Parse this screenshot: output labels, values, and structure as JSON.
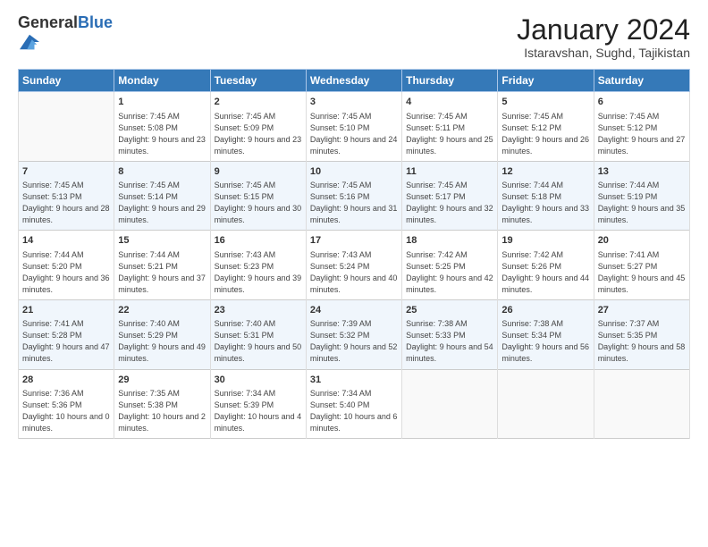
{
  "header": {
    "logo_general": "General",
    "logo_blue": "Blue",
    "month_title": "January 2024",
    "location": "Istaravshan, Sughd, Tajikistan"
  },
  "days_of_week": [
    "Sunday",
    "Monday",
    "Tuesday",
    "Wednesday",
    "Thursday",
    "Friday",
    "Saturday"
  ],
  "weeks": [
    [
      {
        "day": "",
        "sunrise": "",
        "sunset": "",
        "daylight": ""
      },
      {
        "day": "1",
        "sunrise": "7:45 AM",
        "sunset": "5:08 PM",
        "daylight": "9 hours and 23 minutes."
      },
      {
        "day": "2",
        "sunrise": "7:45 AM",
        "sunset": "5:09 PM",
        "daylight": "9 hours and 23 minutes."
      },
      {
        "day": "3",
        "sunrise": "7:45 AM",
        "sunset": "5:10 PM",
        "daylight": "9 hours and 24 minutes."
      },
      {
        "day": "4",
        "sunrise": "7:45 AM",
        "sunset": "5:11 PM",
        "daylight": "9 hours and 25 minutes."
      },
      {
        "day": "5",
        "sunrise": "7:45 AM",
        "sunset": "5:12 PM",
        "daylight": "9 hours and 26 minutes."
      },
      {
        "day": "6",
        "sunrise": "7:45 AM",
        "sunset": "5:12 PM",
        "daylight": "9 hours and 27 minutes."
      }
    ],
    [
      {
        "day": "7",
        "sunrise": "7:45 AM",
        "sunset": "5:13 PM",
        "daylight": "9 hours and 28 minutes."
      },
      {
        "day": "8",
        "sunrise": "7:45 AM",
        "sunset": "5:14 PM",
        "daylight": "9 hours and 29 minutes."
      },
      {
        "day": "9",
        "sunrise": "7:45 AM",
        "sunset": "5:15 PM",
        "daylight": "9 hours and 30 minutes."
      },
      {
        "day": "10",
        "sunrise": "7:45 AM",
        "sunset": "5:16 PM",
        "daylight": "9 hours and 31 minutes."
      },
      {
        "day": "11",
        "sunrise": "7:45 AM",
        "sunset": "5:17 PM",
        "daylight": "9 hours and 32 minutes."
      },
      {
        "day": "12",
        "sunrise": "7:44 AM",
        "sunset": "5:18 PM",
        "daylight": "9 hours and 33 minutes."
      },
      {
        "day": "13",
        "sunrise": "7:44 AM",
        "sunset": "5:19 PM",
        "daylight": "9 hours and 35 minutes."
      }
    ],
    [
      {
        "day": "14",
        "sunrise": "7:44 AM",
        "sunset": "5:20 PM",
        "daylight": "9 hours and 36 minutes."
      },
      {
        "day": "15",
        "sunrise": "7:44 AM",
        "sunset": "5:21 PM",
        "daylight": "9 hours and 37 minutes."
      },
      {
        "day": "16",
        "sunrise": "7:43 AM",
        "sunset": "5:23 PM",
        "daylight": "9 hours and 39 minutes."
      },
      {
        "day": "17",
        "sunrise": "7:43 AM",
        "sunset": "5:24 PM",
        "daylight": "9 hours and 40 minutes."
      },
      {
        "day": "18",
        "sunrise": "7:42 AM",
        "sunset": "5:25 PM",
        "daylight": "9 hours and 42 minutes."
      },
      {
        "day": "19",
        "sunrise": "7:42 AM",
        "sunset": "5:26 PM",
        "daylight": "9 hours and 44 minutes."
      },
      {
        "day": "20",
        "sunrise": "7:41 AM",
        "sunset": "5:27 PM",
        "daylight": "9 hours and 45 minutes."
      }
    ],
    [
      {
        "day": "21",
        "sunrise": "7:41 AM",
        "sunset": "5:28 PM",
        "daylight": "9 hours and 47 minutes."
      },
      {
        "day": "22",
        "sunrise": "7:40 AM",
        "sunset": "5:29 PM",
        "daylight": "9 hours and 49 minutes."
      },
      {
        "day": "23",
        "sunrise": "7:40 AM",
        "sunset": "5:31 PM",
        "daylight": "9 hours and 50 minutes."
      },
      {
        "day": "24",
        "sunrise": "7:39 AM",
        "sunset": "5:32 PM",
        "daylight": "9 hours and 52 minutes."
      },
      {
        "day": "25",
        "sunrise": "7:38 AM",
        "sunset": "5:33 PM",
        "daylight": "9 hours and 54 minutes."
      },
      {
        "day": "26",
        "sunrise": "7:38 AM",
        "sunset": "5:34 PM",
        "daylight": "9 hours and 56 minutes."
      },
      {
        "day": "27",
        "sunrise": "7:37 AM",
        "sunset": "5:35 PM",
        "daylight": "9 hours and 58 minutes."
      }
    ],
    [
      {
        "day": "28",
        "sunrise": "7:36 AM",
        "sunset": "5:36 PM",
        "daylight": "10 hours and 0 minutes."
      },
      {
        "day": "29",
        "sunrise": "7:35 AM",
        "sunset": "5:38 PM",
        "daylight": "10 hours and 2 minutes."
      },
      {
        "day": "30",
        "sunrise": "7:34 AM",
        "sunset": "5:39 PM",
        "daylight": "10 hours and 4 minutes."
      },
      {
        "day": "31",
        "sunrise": "7:34 AM",
        "sunset": "5:40 PM",
        "daylight": "10 hours and 6 minutes."
      },
      {
        "day": "",
        "sunrise": "",
        "sunset": "",
        "daylight": ""
      },
      {
        "day": "",
        "sunrise": "",
        "sunset": "",
        "daylight": ""
      },
      {
        "day": "",
        "sunrise": "",
        "sunset": "",
        "daylight": ""
      }
    ]
  ],
  "labels": {
    "sunrise": "Sunrise:",
    "sunset": "Sunset:",
    "daylight": "Daylight:"
  }
}
